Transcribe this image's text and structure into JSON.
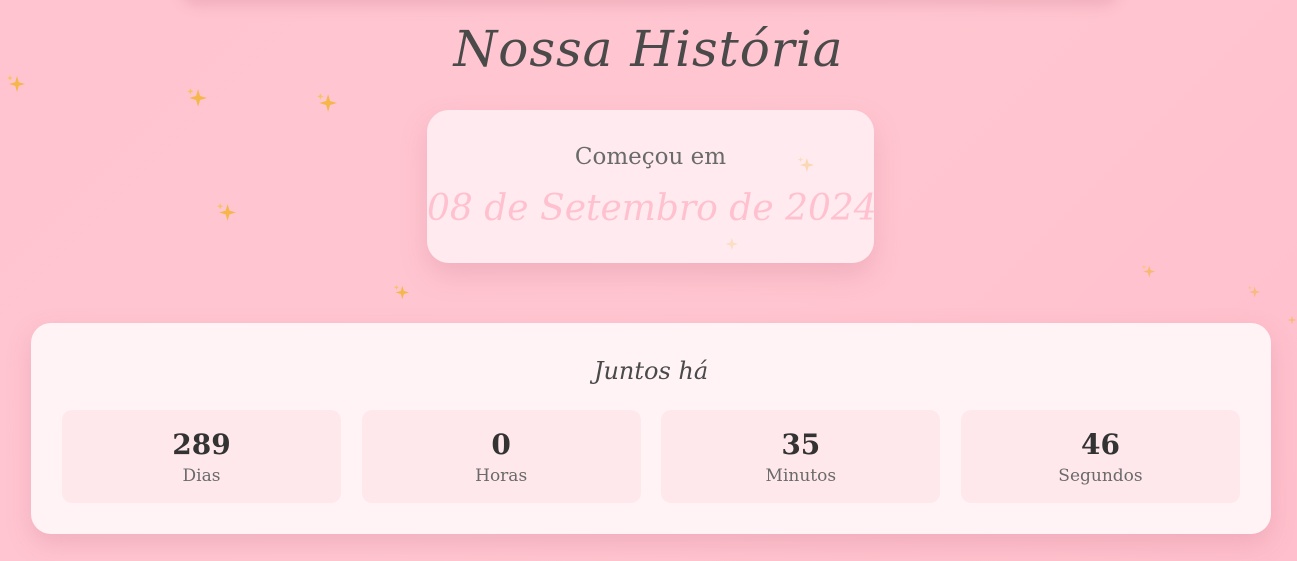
{
  "page": {
    "title": "Nossa História"
  },
  "start_card": {
    "label": "Começou em",
    "date": "08 de Setembro de 2024"
  },
  "counter": {
    "heading": "Juntos há",
    "units": [
      {
        "value": "289",
        "label": "Dias"
      },
      {
        "value": "0",
        "label": "Horas"
      },
      {
        "value": "35",
        "label": "Minutos"
      },
      {
        "value": "46",
        "label": "Segundos"
      }
    ]
  },
  "decor": {
    "sparkle_icon": "sparkles-icon",
    "sparkle_color": "#f5b64a",
    "title_color": "#4a4a4a",
    "date_color": "#ffc1cf"
  }
}
